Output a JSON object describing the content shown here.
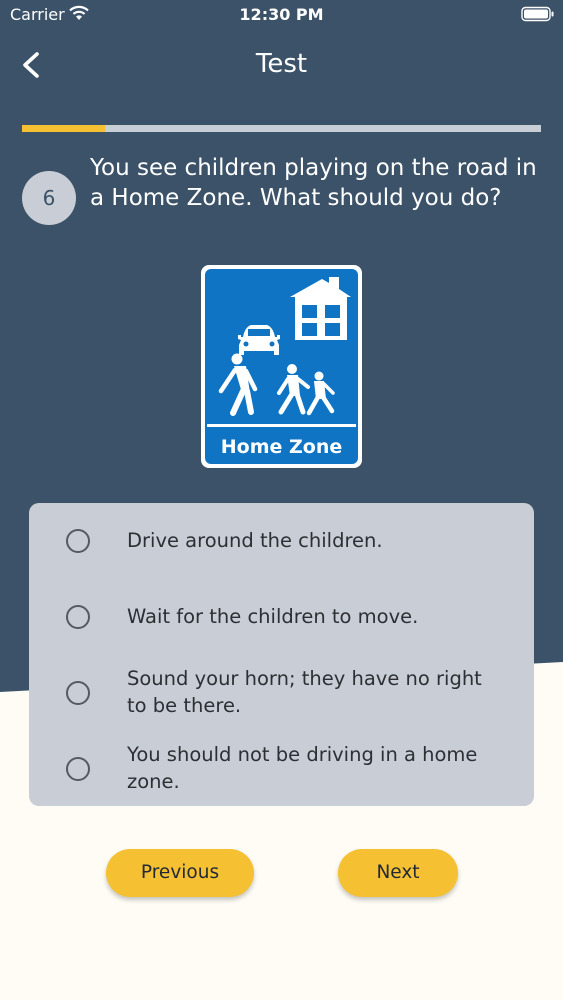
{
  "status_bar": {
    "carrier": "Carrier",
    "time": "12:30 PM"
  },
  "nav": {
    "title": "Test"
  },
  "progress": {
    "fraction": 0.16
  },
  "question": {
    "number": "6",
    "text": "You see children playing on the road in a Home Zone. What should you do?"
  },
  "sign": {
    "label": "Home Zone"
  },
  "options": [
    {
      "label": "Drive around the children."
    },
    {
      "label": "Wait for the children to move."
    },
    {
      "label": "Sound your horn; they have no right to be there."
    },
    {
      "label": "You should not be driving in a home zone."
    }
  ],
  "buttons": {
    "previous": "Previous",
    "next": "Next"
  },
  "colors": {
    "header_bg": "#3b5268",
    "accent": "#f5c031",
    "page_bg": "#fefcf5",
    "card_bg": "#c9ced6",
    "sign_blue": "#0f74c4"
  }
}
